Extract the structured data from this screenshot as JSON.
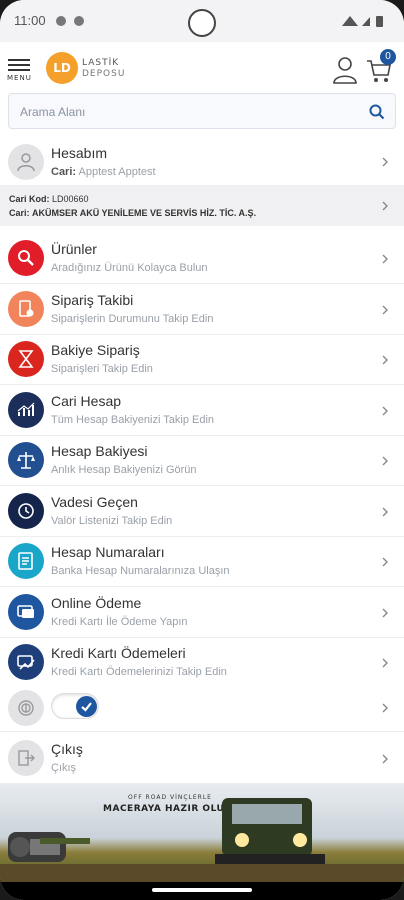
{
  "status": {
    "time": "11:00"
  },
  "header": {
    "menu_label": "MENU",
    "logo_mark": "LD",
    "logo_line1": "LASTİK",
    "logo_line2": "DEPOSU",
    "cart_count": "0"
  },
  "search": {
    "placeholder": "Arama Alanı"
  },
  "account": {
    "title": "Hesabım",
    "sub_label": "Cari:",
    "sub_value": "Apptest Apptest"
  },
  "cari": {
    "code_label": "Cari Kod:",
    "code_value": "LD00660",
    "name_label": "Cari:",
    "name_value": "AKÜMSER AKÜ YENİLEME VE SERVİS HİZ. TİC. A.Ş."
  },
  "menu": [
    {
      "title": "Ürünler",
      "sub": "Aradığınız Ürünü Kolayca Bulun",
      "color": "#e11d2a",
      "icon": "search-icon"
    },
    {
      "title": "Sipariş Takibi",
      "sub": "Siparişlerin Durumunu Takip Edin",
      "color": "#f2845c",
      "icon": "document-icon"
    },
    {
      "title": "Bakiye Sipariş",
      "sub": "Siparişleri Takip Edin",
      "color": "#d9271f",
      "icon": "hourglass-icon"
    },
    {
      "title": "Cari Hesap",
      "sub": "Tüm Hesap Bakiyenizi Takip Edin",
      "color": "#1c2f5a",
      "icon": "chart-icon"
    },
    {
      "title": "Hesap Bakiyesi",
      "sub": "Anlık Hesap Bakiyenizi Görün",
      "color": "#214f8f",
      "icon": "scale-icon"
    },
    {
      "title": "Vadesi Geçen",
      "sub": "Valör Listenizi Takip Edin",
      "color": "#15244a",
      "icon": "clock-icon"
    },
    {
      "title": "Hesap Numaraları",
      "sub": "Banka Hesap Numaralarınıza Ulaşın",
      "color": "#1aa6c9",
      "icon": "ledger-icon"
    },
    {
      "title": "Online Ödeme",
      "sub": "Kredi Kartı İle Ödeme Yapın",
      "color": "#1e56a0",
      "icon": "card-icon"
    },
    {
      "title": "Kredi Kartı Ödemeleri",
      "sub": "Kredi Kartı Ödemelerinizi Takip Edin",
      "color": "#1e3f7a",
      "icon": "card-chart-icon"
    }
  ],
  "fingerprint": {
    "enabled": true
  },
  "logout": {
    "title": "Çıkış",
    "sub": "Çıkış"
  },
  "banner": {
    "line1": "OFF ROAD VİNÇLERLE",
    "line2": "MACERAYA HAZIR OLUN!"
  }
}
